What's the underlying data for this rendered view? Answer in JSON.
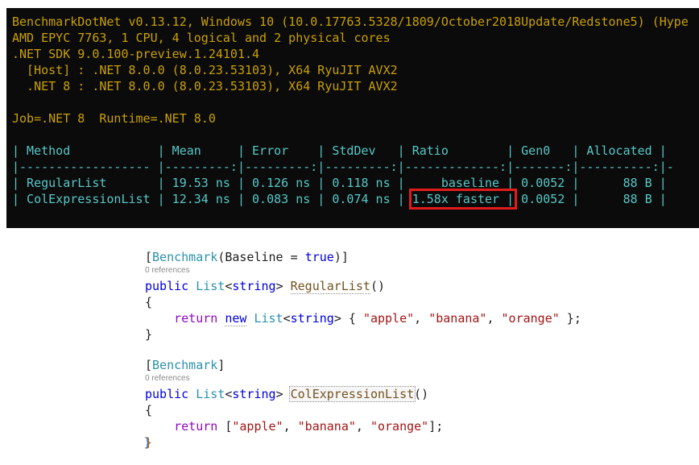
{
  "colors": {
    "terminal_bg": "#0b0b0b",
    "terminal_yellow": "#c9a004",
    "terminal_cyan": "#57c7c7",
    "highlight_red": "#e21b1b",
    "keyword_blue": "#0000e0",
    "type_teal": "#2b91af",
    "control_purple": "#8f08c4",
    "string_red": "#a31515",
    "method_brown": "#74531f",
    "codelens_gray": "#8a8a8a"
  },
  "terminal": {
    "lines": [
      "BenchmarkDotNet v0.13.12, Windows 10 (10.0.17763.5328/1809/October2018Update/Redstone5) (Hype",
      "AMD EPYC 7763, 1 CPU, 4 logical and 2 physical cores",
      ".NET SDK 9.0.100-preview.1.24101.4",
      "  [Host] : .NET 8.0.0 (8.0.23.53103), X64 RyuJIT AVX2",
      "  .NET 8 : .NET 8.0.0 (8.0.23.53103), X64 RyuJIT AVX2"
    ],
    "job_line": "Job=.NET 8  Runtime=.NET 8.0",
    "table": {
      "header": "| Method            | Mean     | Error    | StdDev   | Ratio        | Gen0   | Allocated |",
      "separator": "|------------------ |---------:|---------:|---------:|-------------:|-------:|----------:|-",
      "row_regular": "| RegularList       | 19.53 ns | 0.126 ns | 0.118 ns |     baseline | 0.0052 |      88 B |",
      "row_col_prefix": "| ColExpressionList | 12.34 ns | 0.083 ns | 0.074 ns | ",
      "row_col_highlight": "1.58x faster |",
      "row_col_suffix": " 0.0052 |      88 B |"
    }
  },
  "code": {
    "references_label": "0 references",
    "block_regular": {
      "attribute": [
        {
          "t": "[",
          "c": "d"
        },
        {
          "t": "Benchmark",
          "c": "t",
          "n": "attribute-benchmark"
        },
        {
          "t": "(Baseline = ",
          "c": "d"
        },
        {
          "t": "true",
          "c": "k",
          "n": "keyword-true"
        },
        {
          "t": ")]",
          "c": "d"
        }
      ],
      "signature": [
        {
          "t": "public",
          "c": "k",
          "n": "keyword-public"
        },
        {
          "t": " ",
          "c": "d"
        },
        {
          "t": "List",
          "c": "t",
          "n": "type-list"
        },
        {
          "t": "<",
          "c": "d"
        },
        {
          "t": "string",
          "c": "k",
          "n": "keyword-string"
        },
        {
          "t": "> ",
          "c": "d"
        },
        {
          "t": "RegularList",
          "c": "m",
          "u": true,
          "n": "method-name-regularlist"
        },
        {
          "t": "()",
          "c": "d"
        }
      ],
      "open_brace": [
        {
          "t": "{",
          "c": "d"
        }
      ],
      "body": [
        {
          "t": "    ",
          "c": "d"
        },
        {
          "t": "return",
          "c": "c",
          "n": "keyword-return"
        },
        {
          "t": " ",
          "c": "d"
        },
        {
          "t": "new",
          "c": "k",
          "u": true,
          "n": "keyword-new"
        },
        {
          "t": " ",
          "c": "d"
        },
        {
          "t": "List",
          "c": "t",
          "n": "type-list"
        },
        {
          "t": "<",
          "c": "d"
        },
        {
          "t": "string",
          "c": "k",
          "n": "keyword-string"
        },
        {
          "t": ">",
          "c": "d"
        },
        {
          "t": " { ",
          "c": "d"
        },
        {
          "t": "\"apple\"",
          "c": "s",
          "n": "string-literal"
        },
        {
          "t": ", ",
          "c": "d"
        },
        {
          "t": "\"banana\"",
          "c": "s",
          "n": "string-literal"
        },
        {
          "t": ", ",
          "c": "d"
        },
        {
          "t": "\"orange\"",
          "c": "s",
          "n": "string-literal"
        },
        {
          "t": " };",
          "c": "d"
        }
      ],
      "close_brace": [
        {
          "t": "}",
          "c": "d"
        }
      ]
    },
    "block_collection": {
      "attribute": [
        {
          "t": "[",
          "c": "d"
        },
        {
          "t": "Benchmark",
          "c": "t",
          "n": "attribute-benchmark"
        },
        {
          "t": "]",
          "c": "d"
        }
      ],
      "signature": [
        {
          "t": "public",
          "c": "k",
          "n": "keyword-public"
        },
        {
          "t": " ",
          "c": "d"
        },
        {
          "t": "List",
          "c": "t",
          "n": "type-list"
        },
        {
          "t": "<",
          "c": "d"
        },
        {
          "t": "string",
          "c": "k",
          "n": "keyword-string"
        },
        {
          "t": "> ",
          "c": "d"
        },
        {
          "t": "ColExpressionList",
          "c": "m",
          "box": true,
          "n": "method-name-colexpressionlist"
        },
        {
          "t": "()",
          "c": "d"
        }
      ],
      "open_brace": [
        {
          "t": "{",
          "c": "d"
        }
      ],
      "body": [
        {
          "t": "    ",
          "c": "d"
        },
        {
          "t": "return",
          "c": "c",
          "n": "keyword-return"
        },
        {
          "t": " ",
          "c": "d"
        },
        {
          "t": "[",
          "c": "d"
        },
        {
          "t": "\"apple\"",
          "c": "s",
          "n": "string-literal"
        },
        {
          "t": ", ",
          "c": "d"
        },
        {
          "t": "\"banana\"",
          "c": "s",
          "n": "string-literal"
        },
        {
          "t": ", ",
          "c": "d"
        },
        {
          "t": "\"orange\"",
          "c": "s",
          "n": "string-literal"
        },
        {
          "t": "];",
          "c": "d"
        }
      ],
      "close_brace": [
        {
          "t": "}",
          "c": "bx"
        }
      ]
    }
  }
}
